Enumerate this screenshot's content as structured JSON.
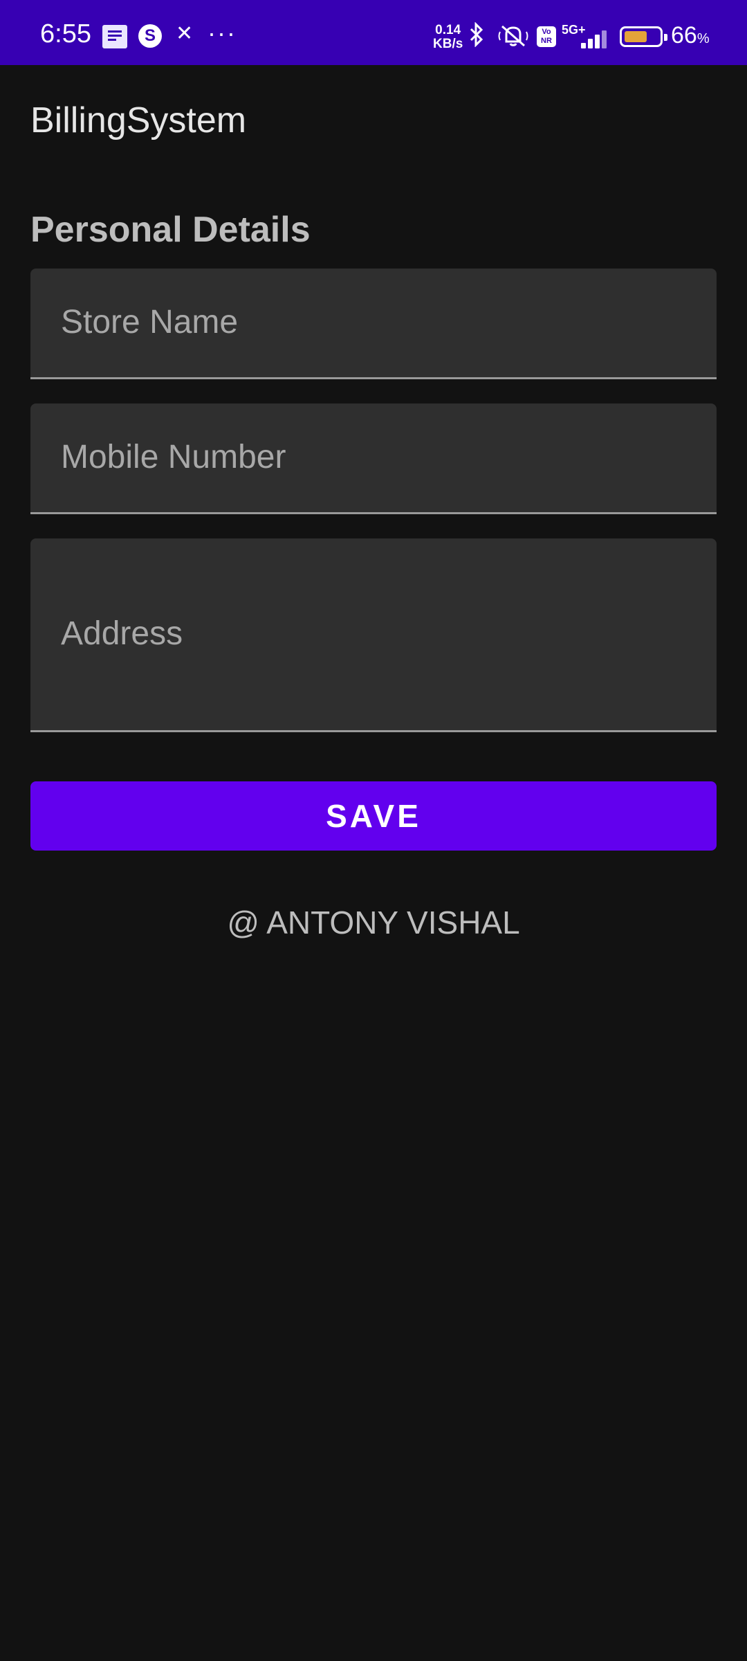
{
  "status_bar": {
    "time": "6:55",
    "net_speed_value": "0.14",
    "net_speed_unit": "KB/s",
    "volte_label": "Vo NR",
    "network_type": "5G+",
    "battery_level": 0.66,
    "battery_percent": "66",
    "battery_percent_sign": "%",
    "icons": [
      "notes-icon",
      "s-app-icon",
      "running-icon",
      "more-icon",
      "bluetooth-icon",
      "mute-icon",
      "volte-icon",
      "signal-icon",
      "battery-icon"
    ]
  },
  "app": {
    "title": "BillingSystem"
  },
  "form": {
    "section_title": "Personal Details",
    "store_name_placeholder": "Store Name",
    "store_name_value": "",
    "mobile_placeholder": "Mobile Number",
    "mobile_value": "",
    "address_placeholder": "Address",
    "address_value": "",
    "save_label": "SAVE"
  },
  "footer": {
    "credit": "@ ANTONY VISHAL"
  },
  "colors": {
    "status_bar": "#3700b3",
    "primary": "#6200ee",
    "background": "#121212",
    "field_background": "#2f2f2f",
    "battery_fill": "#e4a33a"
  }
}
